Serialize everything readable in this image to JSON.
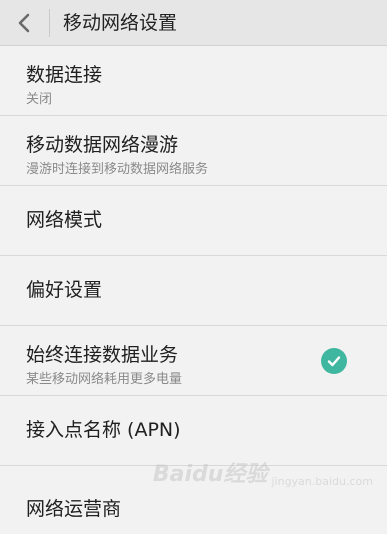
{
  "header": {
    "title": "移动网络设置",
    "back_icon": "chevron-left-icon"
  },
  "settings": [
    {
      "label": "数据连接",
      "sub": "关闭"
    },
    {
      "label": "移动数据网络漫游",
      "sub": "漫游时连接到移动数据网络服务"
    },
    {
      "label": "网络模式"
    },
    {
      "label": "偏好设置"
    },
    {
      "label": "始终连接数据业务",
      "sub": "某些移动网络耗用更多电量",
      "checked": true
    },
    {
      "label": "接入点名称 (APN)"
    },
    {
      "label": "网络运营商"
    }
  ],
  "colors": {
    "accent": "#3fb7a0",
    "header_bg": "#e6e6e6",
    "background": "#f2f2f2"
  },
  "watermark": {
    "text": "Baidu经验",
    "sub": "jingyan.baidu.com"
  }
}
